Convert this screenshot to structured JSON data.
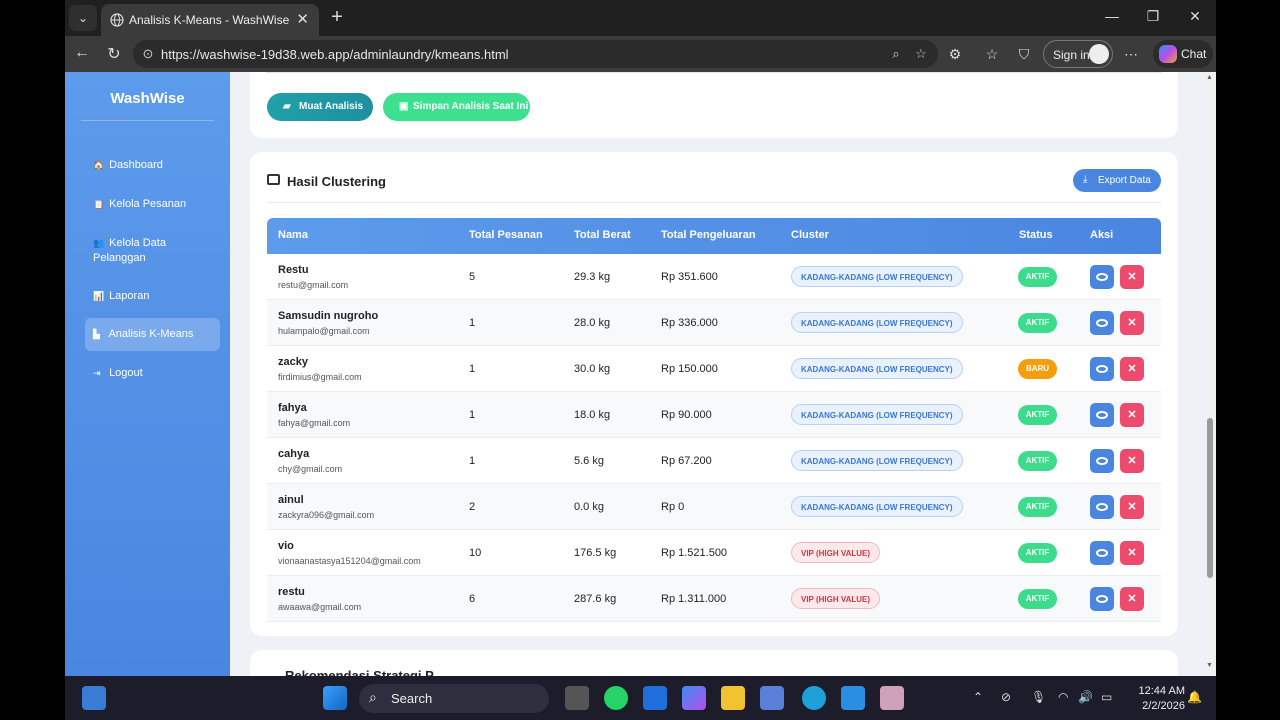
{
  "browser": {
    "tab_title": "Analisis K-Means - WashWise",
    "url": "https://washwise-19d38.web.app/adminlaundry/kmeans.html",
    "signin_label": "Sign in",
    "chat_label": "Chat"
  },
  "sidebar": {
    "brand": "WashWise",
    "items": [
      {
        "label": "Dashboard",
        "icon": "home-icon"
      },
      {
        "label": "Kelola Pesanan",
        "icon": "clipboard-icon"
      },
      {
        "label": "Kelola Data Pelanggan",
        "icon": "users-icon"
      },
      {
        "label": "Laporan",
        "icon": "chart-icon"
      },
      {
        "label": "Analisis K-Means",
        "icon": "bar-chart-icon",
        "active": true
      },
      {
        "label": "Logout",
        "icon": "logout-icon"
      }
    ]
  },
  "actions": {
    "muat_label": "Muat Analisis",
    "simpan_label": "Simpan Analisis Saat Ini"
  },
  "results": {
    "title": "Hasil Clustering",
    "export_label": "Export Data",
    "columns": [
      "Nama",
      "Total Pesanan",
      "Total Berat",
      "Total Pengeluaran",
      "Cluster",
      "Status",
      "Aksi"
    ],
    "rows": [
      {
        "name": "Restu",
        "email": "restu@gmail.com",
        "orders": "5",
        "weight": "29.3 kg",
        "spend": "Rp 351.600",
        "cluster": "KADANG-KADANG (LOW FREQUENCY)",
        "cluster_type": "low",
        "status": "AKTIF"
      },
      {
        "name": "Samsudin nugroho",
        "email": "hulampalo@gmail.com",
        "orders": "1",
        "weight": "28.0 kg",
        "spend": "Rp 336.000",
        "cluster": "KADANG-KADANG (LOW FREQUENCY)",
        "cluster_type": "low",
        "status": "AKTIF"
      },
      {
        "name": "zacky",
        "email": "firdimius@gmail.com",
        "orders": "1",
        "weight": "30.0 kg",
        "spend": "Rp 150.000",
        "cluster": "KADANG-KADANG (LOW FREQUENCY)",
        "cluster_type": "low",
        "status": "BARU"
      },
      {
        "name": "fahya",
        "email": "fahya@gmail.com",
        "orders": "1",
        "weight": "18.0 kg",
        "spend": "Rp 90.000",
        "cluster": "KADANG-KADANG (LOW FREQUENCY)",
        "cluster_type": "low",
        "status": "AKTIF"
      },
      {
        "name": "cahya",
        "email": "chy@gmail.com",
        "orders": "1",
        "weight": "5.6 kg",
        "spend": "Rp 67.200",
        "cluster": "KADANG-KADANG (LOW FREQUENCY)",
        "cluster_type": "low",
        "status": "AKTIF"
      },
      {
        "name": "ainul",
        "email": "zackyra096@gmail.com",
        "orders": "2",
        "weight": "0.0 kg",
        "spend": "Rp 0",
        "cluster": "KADANG-KADANG (LOW FREQUENCY)",
        "cluster_type": "low",
        "status": "AKTIF"
      },
      {
        "name": "vio",
        "email": "vionaanastasya151204@gmail.com",
        "orders": "10",
        "weight": "176.5 kg",
        "spend": "Rp 1.521.500",
        "cluster": "VIP (HIGH VALUE)",
        "cluster_type": "vip",
        "status": "AKTIF"
      },
      {
        "name": "restu",
        "email": "awaawa@gmail.com",
        "orders": "6",
        "weight": "287.6 kg",
        "spend": "Rp 1.311.000",
        "cluster": "VIP (HIGH VALUE)",
        "cluster_type": "vip",
        "status": "AKTIF"
      }
    ]
  },
  "next_section_title": "Rekomendasi Strategi P...",
  "taskbar": {
    "search_label": "Search",
    "time": "12:44 AM",
    "date": "2/2/2026"
  },
  "colors": {
    "accent": "#4a86e0",
    "aktif": "#3ddc8c",
    "baru": "#f59e0b",
    "delete": "#ec4b6e"
  }
}
